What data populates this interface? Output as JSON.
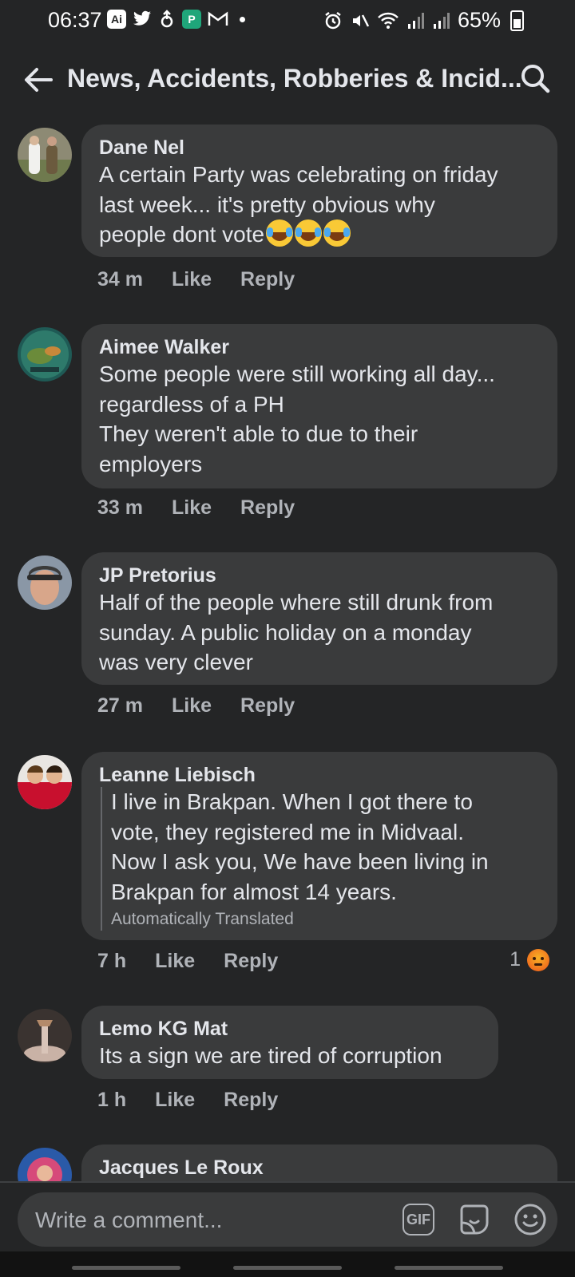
{
  "status_bar": {
    "time": "06:37",
    "ai_badge": "Ai",
    "battery": "65%"
  },
  "header": {
    "title": "News, Accidents, Robberies & Incid...",
    "back_icon": "arrow-left-icon",
    "search_icon": "search-icon"
  },
  "comments": [
    {
      "author": "Dane Nel",
      "text": "A certain Party was celebrating on friday\nlast week... it's pretty obvious why\npeople dont vote",
      "time": "34 m",
      "like": "Like",
      "reply": "Reply"
    },
    {
      "author": "Aimee Walker",
      "text": "Some people were still working all day...\nregardless of a PH\nThey weren't able to due to their\nemployers",
      "time": "33 m",
      "like": "Like",
      "reply": "Reply"
    },
    {
      "author": "JP Pretorius",
      "text": "Half of the people where still drunk from\nsunday. A public holiday on a monday\nwas very clever",
      "time": "27 m",
      "like": "Like",
      "reply": "Reply"
    },
    {
      "author": "Leanne Liebisch",
      "text": "I live in Brakpan. When I got there to\nvote, they registered me in Midvaal.\nNow I ask you, We have been living in\nBrakpan for almost 14 years.",
      "translated_note": "Automatically Translated",
      "time": "7 h",
      "like": "Like",
      "reply": "Reply",
      "reaction_count": "1"
    },
    {
      "author": "Lemo KG Mat",
      "text": "Its a sign we are tired of corruption",
      "time": "1 h",
      "like": "Like",
      "reply": "Reply"
    },
    {
      "author": "Jacques Le Roux"
    }
  ],
  "composer": {
    "placeholder": "Write a comment...",
    "gif_label": "GIF"
  },
  "colors": {
    "background": "#242526",
    "bubble": "#3a3b3c",
    "text_primary": "#e4e6eb",
    "text_secondary": "#b0b3b8"
  }
}
